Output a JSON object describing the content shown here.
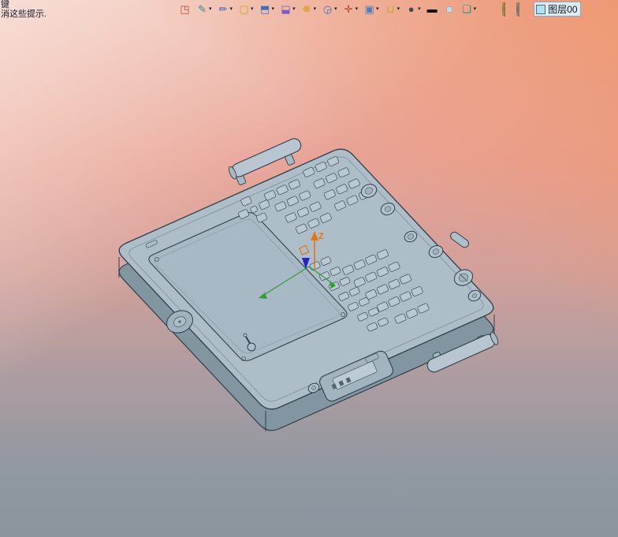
{
  "hints": {
    "line1": "键",
    "line2": "消这些提示."
  },
  "toolbar": {
    "dropdown_glyph": "▾",
    "items": [
      {
        "name": "finish-sketch",
        "glyph": "◳"
      },
      {
        "name": "sketch",
        "glyph": "✎"
      },
      {
        "name": "line",
        "glyph": "✏"
      },
      {
        "name": "wire-box",
        "glyph": "▢"
      },
      {
        "name": "extrude",
        "glyph": "⬒"
      },
      {
        "name": "revolve",
        "glyph": "⬓"
      },
      {
        "name": "pattern",
        "glyph": "❋"
      },
      {
        "name": "sweep",
        "glyph": "◶"
      },
      {
        "name": "datum-point",
        "glyph": "✛"
      },
      {
        "name": "datum-plane",
        "glyph": "▣"
      },
      {
        "name": "profile",
        "glyph": "⊔"
      },
      {
        "name": "render-mode",
        "glyph": "●"
      },
      {
        "name": "line-width",
        "glyph": "▬"
      },
      {
        "name": "current-color",
        "glyph": "■"
      },
      {
        "name": "surface-display",
        "glyph": "❏"
      }
    ]
  },
  "layer_bar": {
    "layer_label": "图层00"
  },
  "viewport": {
    "axes": {
      "z_label": "Z"
    }
  },
  "colors": {
    "accent_orange": "#e07818",
    "axis_green": "#2f9e2f",
    "axis_blue": "#2222cc",
    "model_fill": "#adbec8",
    "model_line": "#2f3e4a",
    "model_side": "#8296a2",
    "panel_fill": "#a7b9c4",
    "button_fill": "#b9c9d3",
    "knob_fill": "#b3c3cd",
    "detail_line": "#53646f"
  }
}
